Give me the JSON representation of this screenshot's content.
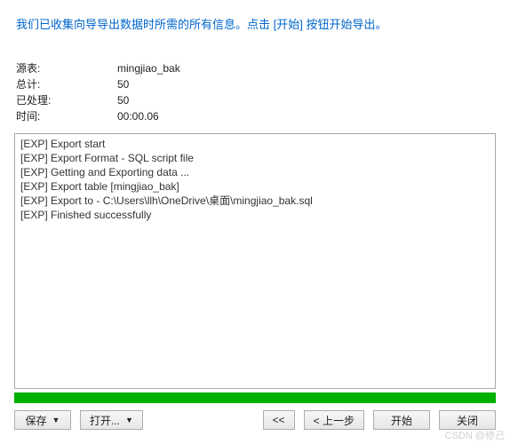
{
  "header": {
    "message": "我们已收集向导导出数据时所需的所有信息。点击 [开始] 按钮开始导出。"
  },
  "info": {
    "source_table_label": "源表:",
    "source_table_value": "mingjiao_bak",
    "total_label": "总计:",
    "total_value": "50",
    "processed_label": "已处理:",
    "processed_value": "50",
    "time_label": "时间:",
    "time_value": "00:00.06"
  },
  "log": [
    "[EXP] Export start",
    "[EXP] Export Format - SQL script file",
    "[EXP] Getting and Exporting data ...",
    "[EXP] Export table [mingjiao_bak]",
    "[EXP] Export to - C:\\Users\\llh\\OneDrive\\桌面\\mingjiao_bak.sql",
    "[EXP] Finished successfully"
  ],
  "progress": {
    "percent": 100,
    "color": "#00b000"
  },
  "buttons": {
    "save": "保存",
    "open": "打开...",
    "first": "<<",
    "prev": "< 上一步",
    "start": "开始",
    "close": "关闭"
  },
  "watermark": "CSDN @修己"
}
